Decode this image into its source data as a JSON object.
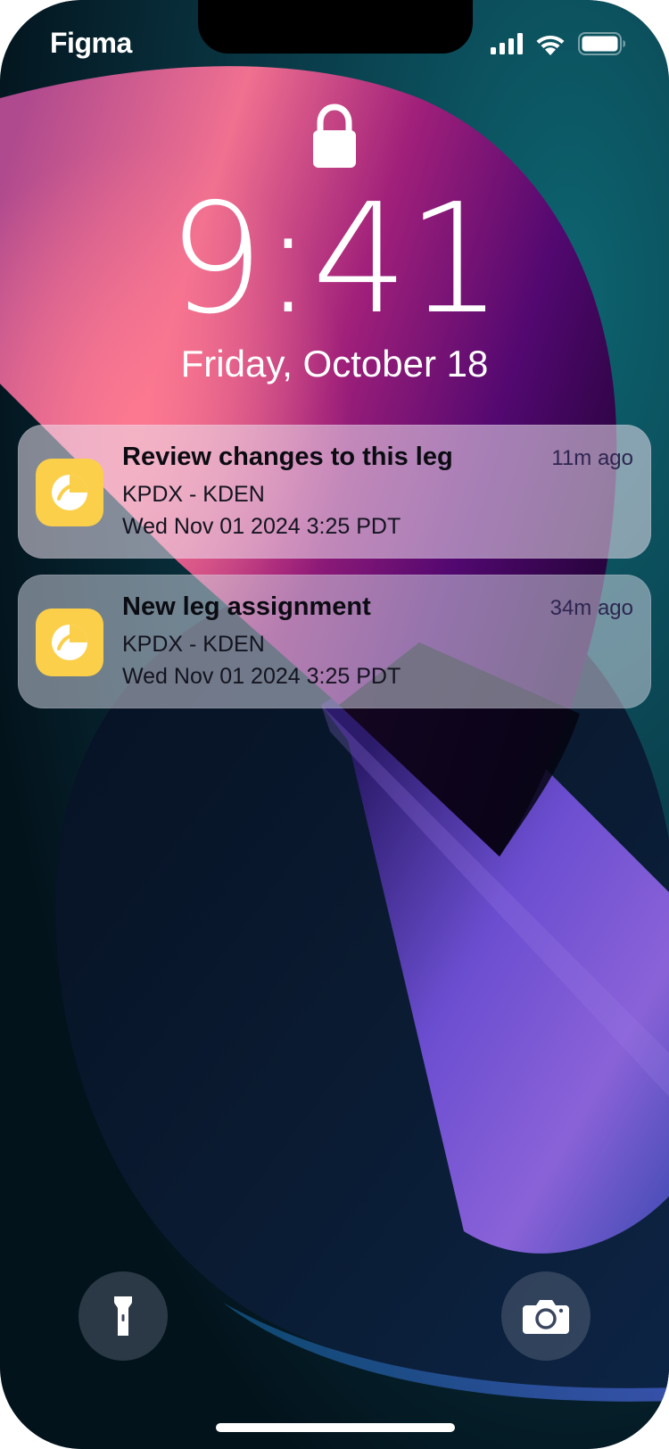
{
  "status_bar": {
    "app_name": "Figma",
    "icons": [
      "cellular-signal-icon",
      "wifi-icon",
      "battery-icon"
    ]
  },
  "lock_screen": {
    "lock_icon": "lock-icon",
    "time": "9:41",
    "date": "Friday, October 18"
  },
  "notifications": [
    {
      "app_icon": "flight-app-icon",
      "title": "Review changes to this leg",
      "age": "11m ago",
      "route": "KPDX - KDEN",
      "datetime": "Wed Nov 01 2024 3:25 PDT"
    },
    {
      "app_icon": "flight-app-icon",
      "title": "New leg assignment",
      "age": "34m ago",
      "route": "KPDX - KDEN",
      "datetime": "Wed Nov 01 2024 3:25 PDT"
    }
  ],
  "quick_actions": {
    "left_icon": "flashlight-icon",
    "right_icon": "camera-icon"
  },
  "colors": {
    "app_icon_bg": "#fbcf49",
    "wallpaper_base": "#041a24",
    "wallpaper_magenta": "#c0357a",
    "wallpaper_purple": "#7a4fcf",
    "wallpaper_teal": "#0c5a6a"
  }
}
